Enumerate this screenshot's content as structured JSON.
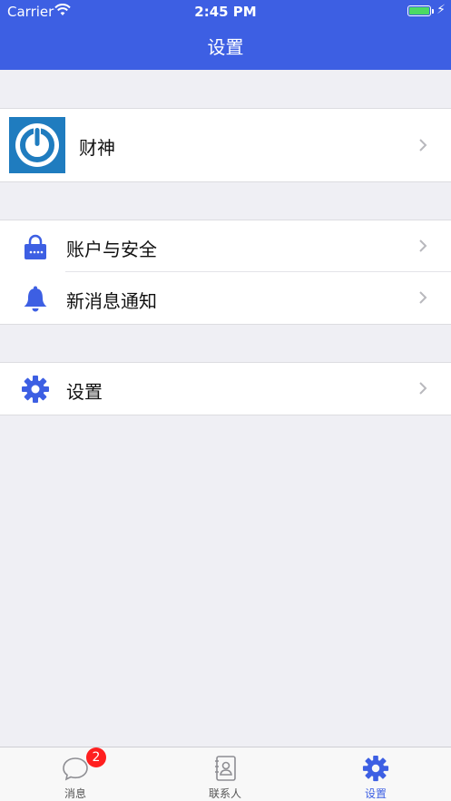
{
  "status_bar": {
    "carrier": "Carrier",
    "time": "2:45 PM",
    "battery_level": 1.0
  },
  "nav": {
    "title": "设置"
  },
  "profile": {
    "name": "财神",
    "avatar_icon": "power-logo"
  },
  "security_group": {
    "items": [
      {
        "label": "账户与安全",
        "icon": "lock-icon"
      },
      {
        "label": "新消息通知",
        "icon": "bell-icon"
      }
    ]
  },
  "settings_group": {
    "items": [
      {
        "label": "设置",
        "icon": "gear-icon"
      }
    ]
  },
  "tabbar": {
    "items": [
      {
        "label": "消息",
        "icon": "chat-bubble-icon",
        "badge": "2"
      },
      {
        "label": "联系人",
        "icon": "contacts-icon"
      },
      {
        "label": "设置",
        "icon": "gear-icon",
        "active": true
      }
    ]
  },
  "colors": {
    "accent": "#3d5fe3",
    "badge": "#ff1f1f",
    "background": "#efeff4"
  }
}
